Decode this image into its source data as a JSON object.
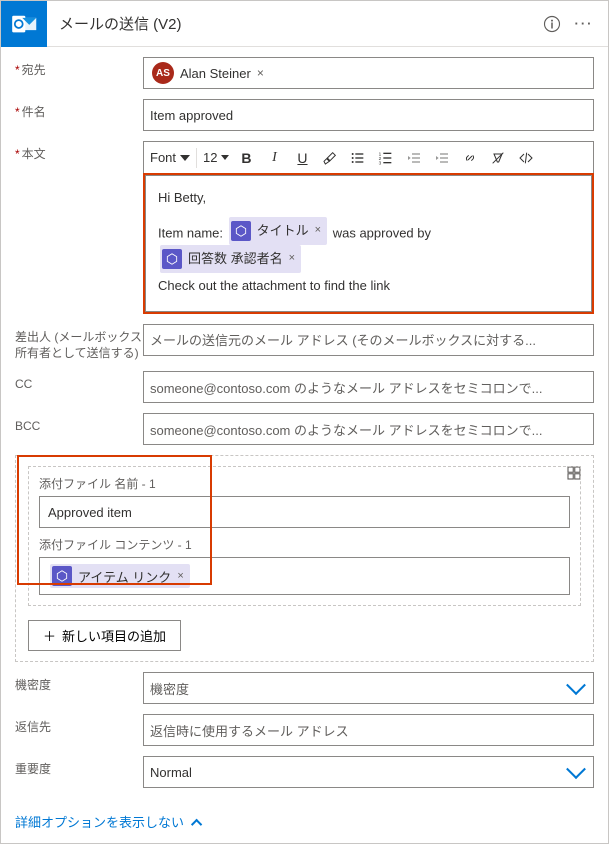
{
  "header": {
    "title": "メールの送信 (V2)"
  },
  "labels": {
    "to": "宛先",
    "subject": "件名",
    "body": "本文",
    "from": "差出人 (メールボックス所有者として送信する)",
    "cc": "CC",
    "bcc": "BCC",
    "sensitivity": "機密度",
    "replyTo": "返信先",
    "importance": "重要度"
  },
  "to": {
    "recipient": {
      "initials": "AS",
      "name": "Alan Steiner"
    }
  },
  "subject": {
    "value": "Item approved"
  },
  "editor": {
    "font": "Font",
    "size": "12",
    "greeting": "Hi Betty,",
    "line2_pre": "Item name: ",
    "token1": "タイトル",
    "line2_post": " was approved by ",
    "token2": "回答数 承認者名",
    "line3": "Check out the attachment to find the link"
  },
  "from": {
    "placeholder": "メールの送信元のメール アドレス (そのメールボックスに対する..."
  },
  "cc": {
    "placeholder": "someone@contoso.com のようなメール アドレスをセミコロンで..."
  },
  "bcc": {
    "placeholder": "someone@contoso.com のようなメール アドレスをセミコロンで..."
  },
  "attach": {
    "nameLabel": "添付ファイル 名前 - 1",
    "nameValue": "Approved item",
    "contentLabel": "添付ファイル コンテンツ - 1",
    "token": "アイテム リンク",
    "addNew": "新しい項目の追加"
  },
  "sensitivity": {
    "placeholder": "機密度"
  },
  "replyTo": {
    "placeholder": "返信時に使用するメール アドレス"
  },
  "importance": {
    "value": "Normal"
  },
  "footer": {
    "link": "詳細オプションを表示しない"
  }
}
